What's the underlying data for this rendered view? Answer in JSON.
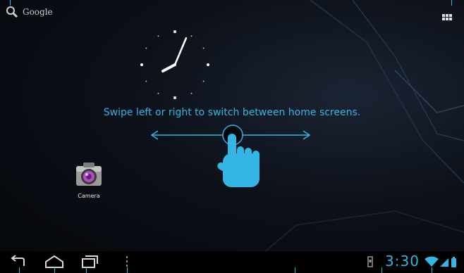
{
  "search": {
    "label": "Google"
  },
  "hint": {
    "text": "Swipe left or right to switch between home screens."
  },
  "shortcuts": [
    {
      "label": "Camera"
    }
  ],
  "status": {
    "time": "3:30"
  },
  "colors": {
    "accent": "#33b5e5",
    "background": "#05070b"
  },
  "icons": [
    "search-icon",
    "apps-grid-icon",
    "back-icon",
    "home-icon",
    "recent-apps-icon",
    "menu-icon",
    "sd-card-icon",
    "wifi-icon",
    "signal-icon",
    "battery-icon"
  ]
}
